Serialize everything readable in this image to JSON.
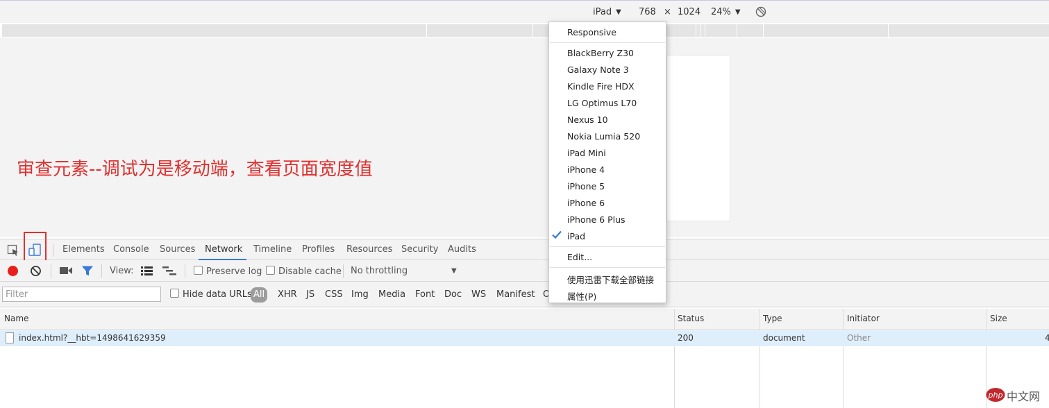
{
  "device_toolbar": {
    "device": "iPad",
    "width": "768",
    "times": "×",
    "height": "1024",
    "zoom": "24%"
  },
  "annotation": "审查元素--调试为是移动端，查看页面宽度值",
  "devtools_tabs": [
    "Elements",
    "Console",
    "Sources",
    "Network",
    "Timeline",
    "Profiles",
    "Resources",
    "Security",
    "Audits"
  ],
  "active_tab": "Network",
  "network_toolbar": {
    "view_label": "View:",
    "preserve_log": "Preserve log",
    "disable_cache": "Disable cache",
    "throttling": "No throttling"
  },
  "filter_bar": {
    "placeholder": "Filter",
    "hide_data_urls": "Hide data URLs",
    "types": [
      "All",
      "XHR",
      "JS",
      "CSS",
      "Img",
      "Media",
      "Font",
      "Doc",
      "WS",
      "Manifest",
      "O"
    ]
  },
  "table": {
    "columns": [
      "Name",
      "Status",
      "Type",
      "Initiator",
      "Size"
    ],
    "rows": [
      {
        "name": "index.html?__hbt=1498641629359",
        "status": "200",
        "type": "document",
        "initiator": "Other",
        "size": "4"
      }
    ]
  },
  "device_menu": {
    "responsive": "Responsive",
    "devices": [
      "BlackBerry Z30",
      "Galaxy Note 3",
      "Kindle Fire HDX",
      "LG Optimus L70",
      "Nexus 10",
      "Nokia Lumia 520",
      "iPad Mini",
      "iPhone 4",
      "iPhone 5",
      "iPhone 6",
      "iPhone 6 Plus",
      "iPad"
    ],
    "selected": "iPad",
    "edit": "Edit...",
    "extra": [
      "使用迅雷下载全部链接",
      "属性(P)"
    ]
  },
  "watermark": "php中文网",
  "colors": {
    "accent": "#3879d9",
    "record": "#e8201d",
    "annotation": "#e03030",
    "selected_row": "#dfeefb",
    "watermark": "#c1272d"
  }
}
